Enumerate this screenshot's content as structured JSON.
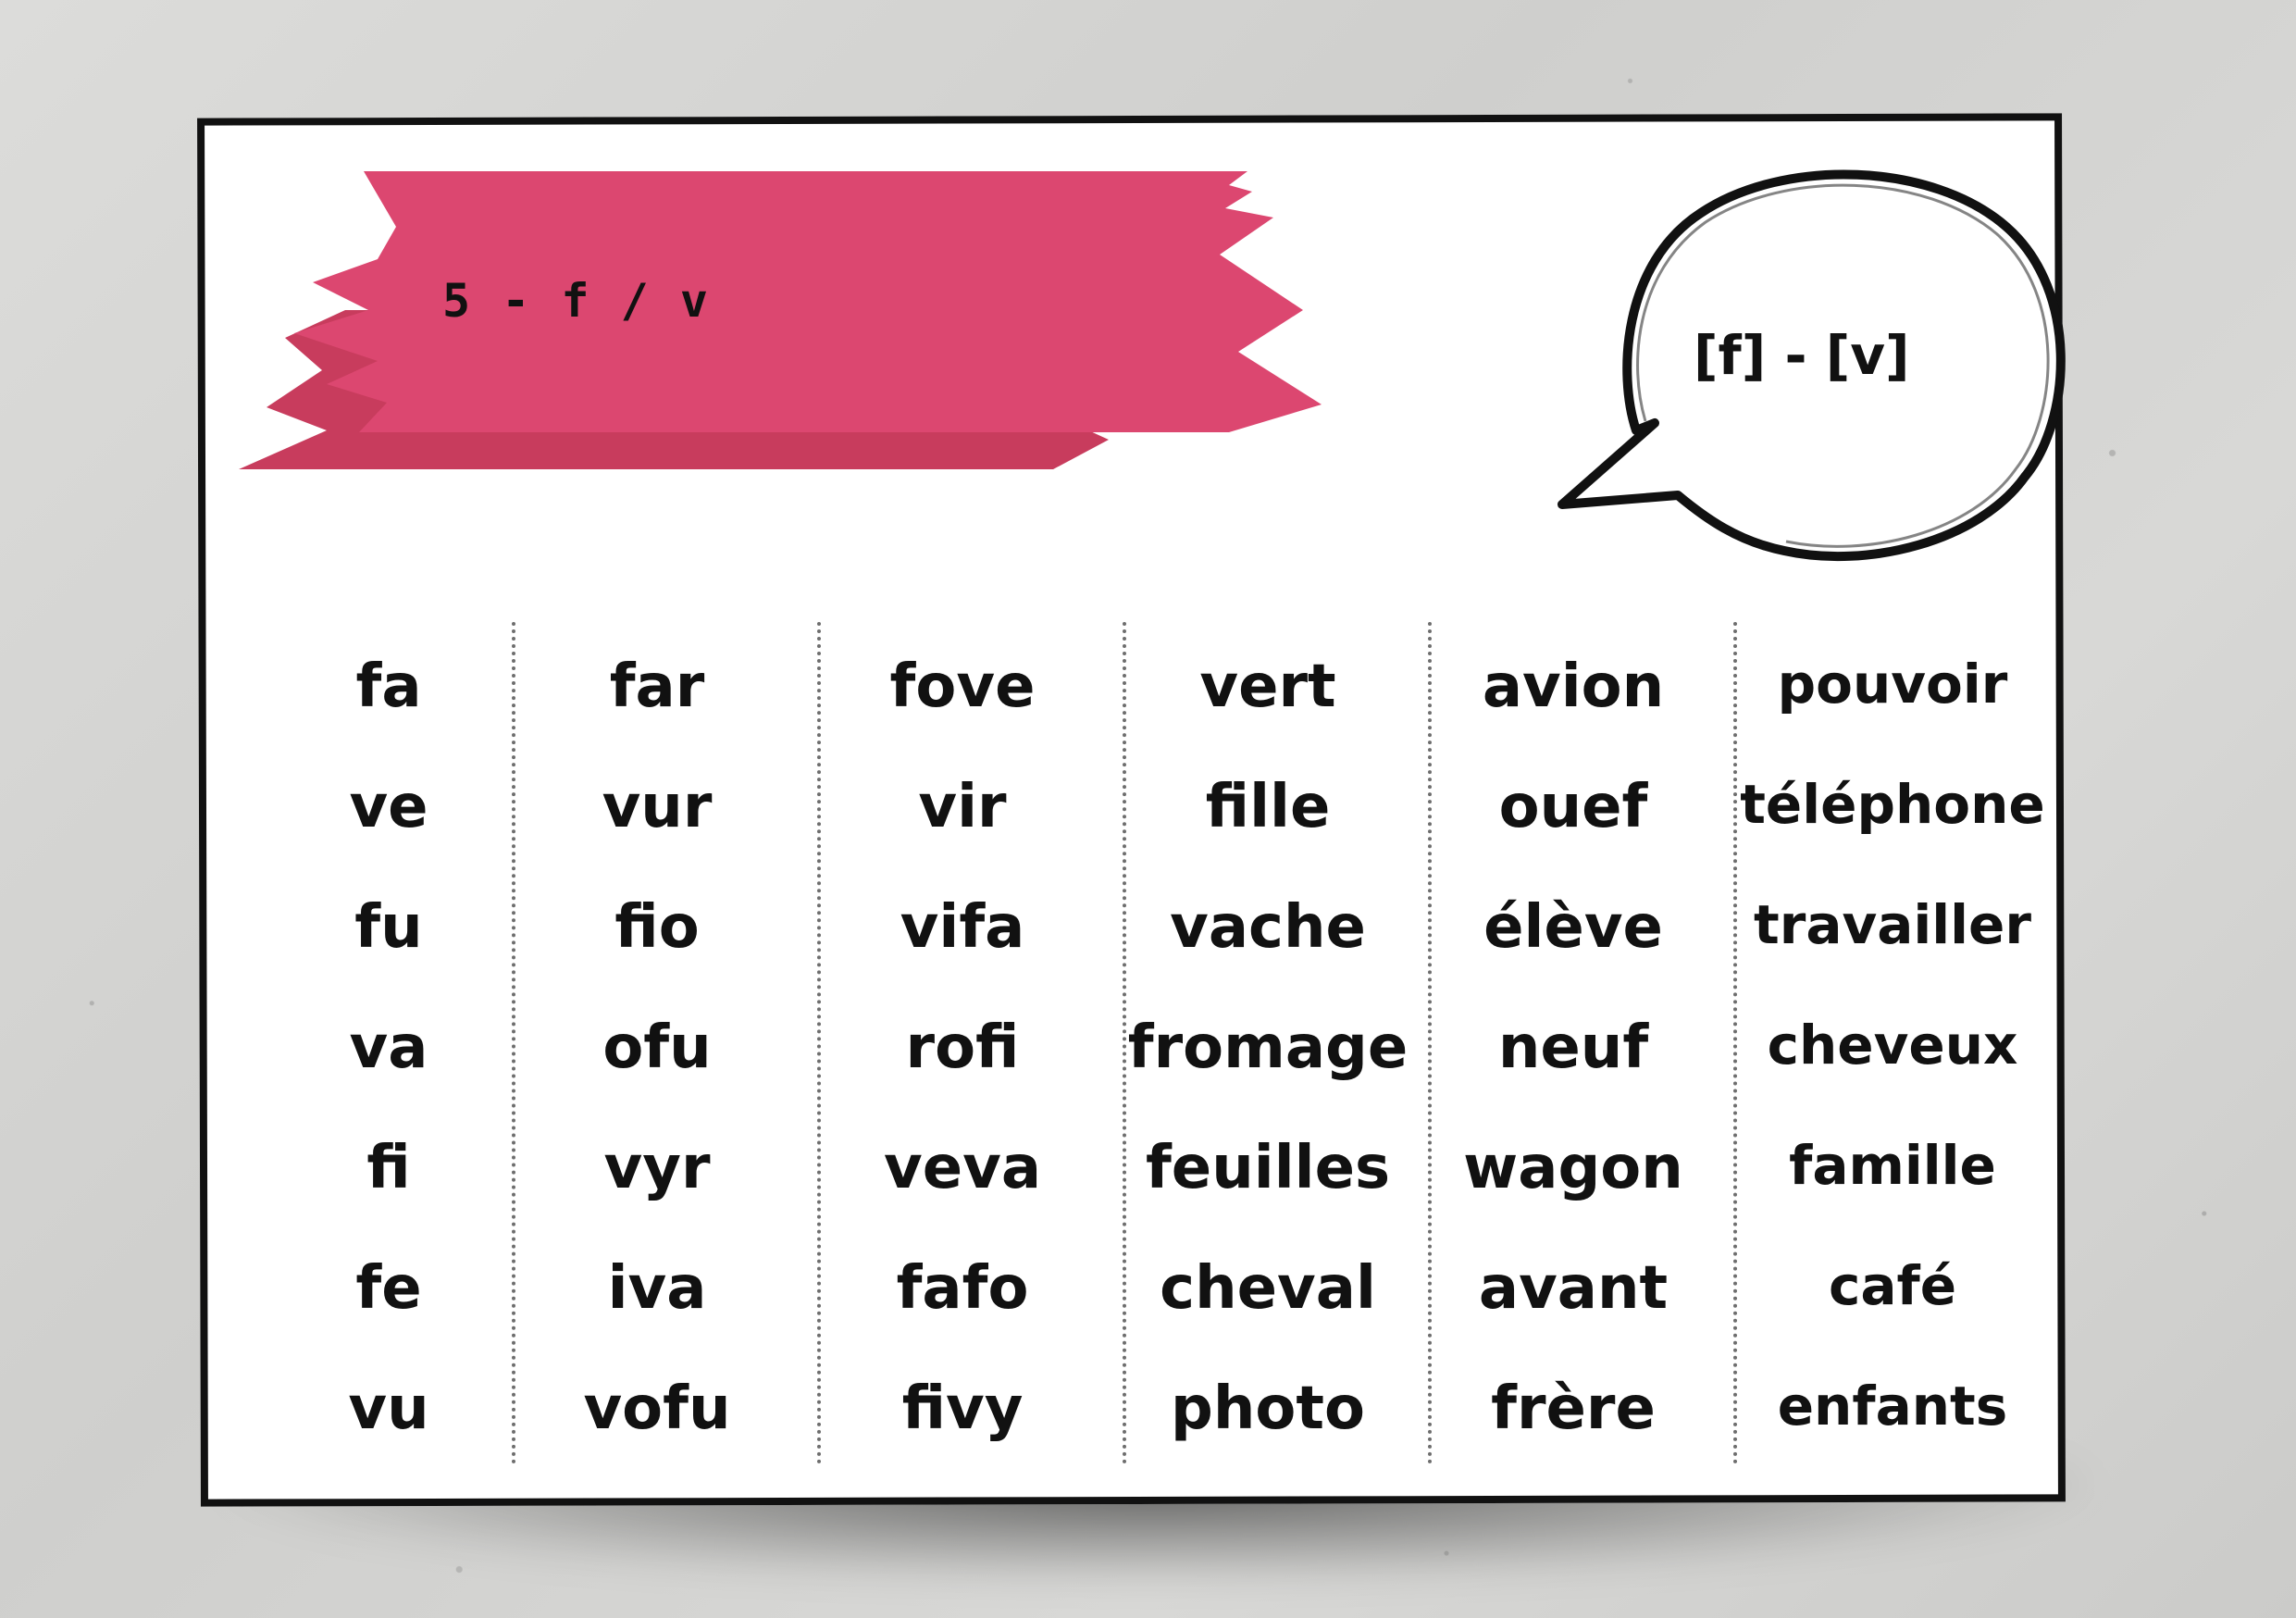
{
  "card": {
    "title": "5 - f / v",
    "phonemes": "[f] - [v]"
  },
  "colors": {
    "banner": "#dc4770",
    "banner_dark": "#c83c5d",
    "ink": "#111111",
    "background": "#d6d6d4"
  },
  "columns": [
    {
      "words": [
        "fa",
        "ve",
        "fu",
        "va",
        "fi",
        "fe",
        "vu"
      ]
    },
    {
      "words": [
        "far",
        "vur",
        "fio",
        "ofu",
        "vyr",
        "iva",
        "vofu"
      ]
    },
    {
      "words": [
        "fove",
        "vir",
        "vifa",
        "rofi",
        "veva",
        "fafo",
        "fivy"
      ]
    },
    {
      "words": [
        "vert",
        "fille",
        "vache",
        "fromage",
        "feuilles",
        "cheval",
        "photo"
      ]
    },
    {
      "words": [
        "avion",
        "ouef",
        "élève",
        "neuf",
        "wagon",
        "avant",
        "frère"
      ]
    },
    {
      "words": [
        "pouvoir",
        "téléphone",
        "travailler",
        "cheveux",
        "famille",
        "café",
        "enfants"
      ]
    }
  ]
}
